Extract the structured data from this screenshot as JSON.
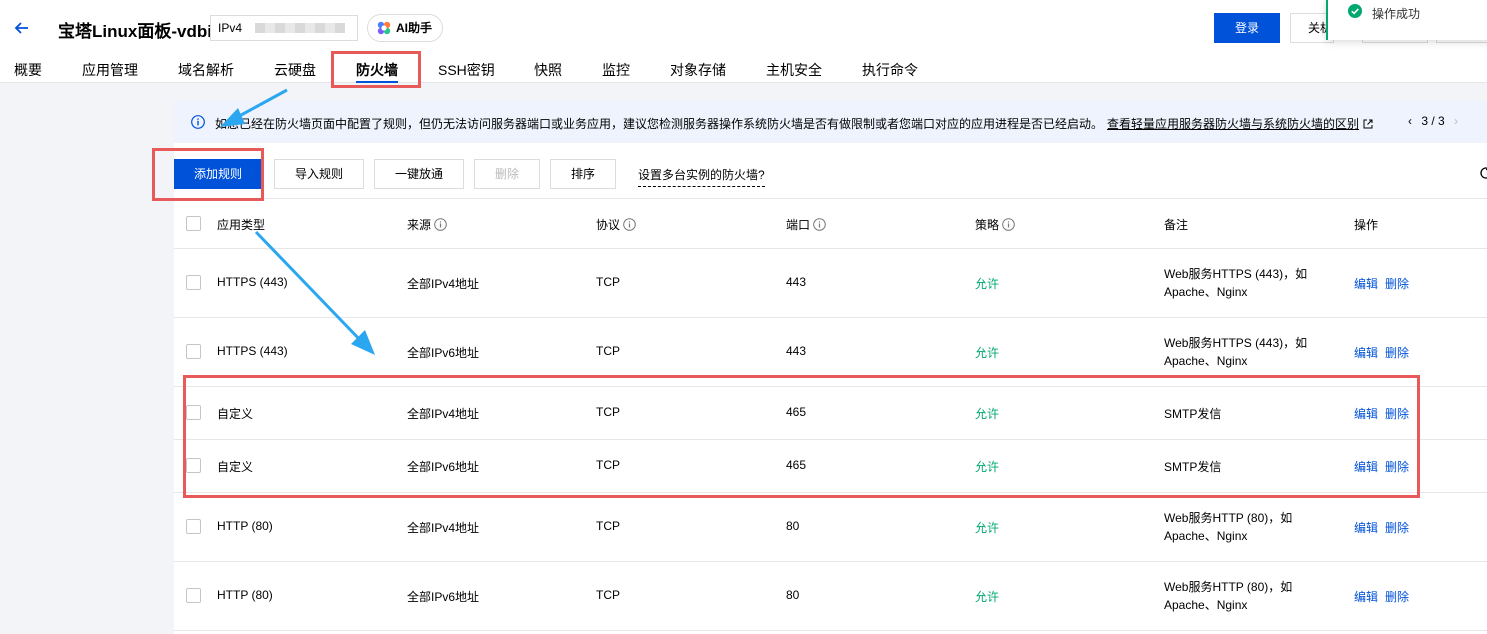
{
  "header": {
    "title": "宝塔Linux面板-vdbi",
    "ip_label": "IPv4",
    "ai_label": "AI助手",
    "login_label": "登录",
    "shutdown_label": "关机"
  },
  "toast": {
    "text": "操作成功"
  },
  "tabs": [
    {
      "label": "概要"
    },
    {
      "label": "应用管理"
    },
    {
      "label": "域名解析"
    },
    {
      "label": "云硬盘"
    },
    {
      "label": "防火墙"
    },
    {
      "label": "SSH密钥"
    },
    {
      "label": "快照"
    },
    {
      "label": "监控"
    },
    {
      "label": "对象存储"
    },
    {
      "label": "主机安全"
    },
    {
      "label": "执行命令"
    }
  ],
  "notice": {
    "text": "如您已经在防火墙页面中配置了规则，但仍无法访问服务器端口或业务应用，建议您检测服务器操作系统防火墙是否有做限制或者您端口对应的应用进程是否已经启动。",
    "link": "查看轻量应用服务器防火墙与系统防火墙的区别",
    "page": "3 / 3"
  },
  "toolbar": {
    "add": "添加规则",
    "import": "导入规则",
    "open_all": "一键放通",
    "delete": "删除",
    "sort": "排序",
    "multi": "设置多台实例的防火墙?"
  },
  "table": {
    "headers": {
      "type": "应用类型",
      "source": "来源",
      "protocol": "协议",
      "port": "端口",
      "policy": "策略",
      "note": "备注",
      "action": "操作"
    },
    "rows": [
      {
        "type": "HTTPS (443)",
        "source": "全部IPv4地址",
        "protocol": "TCP",
        "port": "443",
        "policy": "允许",
        "note1": "Web服务HTTPS (443)，如",
        "note2": "Apache、Nginx",
        "edit": "编辑",
        "delete": "删除"
      },
      {
        "type": "HTTPS (443)",
        "source": "全部IPv6地址",
        "protocol": "TCP",
        "port": "443",
        "policy": "允许",
        "note1": "Web服务HTTPS (443)，如",
        "note2": "Apache、Nginx",
        "edit": "编辑",
        "delete": "删除"
      },
      {
        "type": "自定义",
        "source": "全部IPv4地址",
        "protocol": "TCP",
        "port": "465",
        "policy": "允许",
        "note1": "SMTP发信",
        "note2": "",
        "edit": "编辑",
        "delete": "删除"
      },
      {
        "type": "自定义",
        "source": "全部IPv6地址",
        "protocol": "TCP",
        "port": "465",
        "policy": "允许",
        "note1": "SMTP发信",
        "note2": "",
        "edit": "编辑",
        "delete": "删除"
      },
      {
        "type": "HTTP (80)",
        "source": "全部IPv4地址",
        "protocol": "TCP",
        "port": "80",
        "policy": "允许",
        "note1": "Web服务HTTP (80)，如",
        "note2": "Apache、Nginx",
        "edit": "编辑",
        "delete": "删除"
      },
      {
        "type": "HTTP (80)",
        "source": "全部IPv6地址",
        "protocol": "TCP",
        "port": "80",
        "policy": "允许",
        "note1": "Web服务HTTP (80)，如",
        "note2": "Apache、Nginx",
        "edit": "编辑",
        "delete": "删除"
      }
    ]
  },
  "colors": {
    "primary": "#0052d9",
    "allow": "#00a870",
    "annotation": "#e85a5a",
    "arrow": "#2aa7f0"
  }
}
